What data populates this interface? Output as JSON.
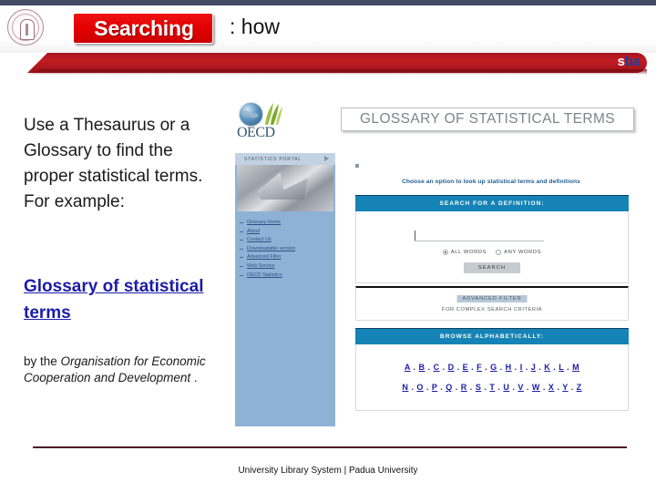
{
  "header": {
    "title_chip": "Searching",
    "title_rest": ": how",
    "brand_logo": {
      "s": "s",
      "b": "b",
      "a": "a"
    },
    "seal_name": "university-seal",
    "band_color": "#c31d22",
    "topbar_color": "#434a63"
  },
  "left_column": {
    "body_text": "Use a Thesaurus or a Glossary to find the proper statistical terms. For example:",
    "link_text": "Glossary of statistical terms",
    "link_color": "#1c1ca8",
    "credit_prefix": "by the ",
    "credit_italic": "Organisation for Economic Cooperation and Development",
    "credit_suffix": " ."
  },
  "screenshot": {
    "oecd_wordmark": "OECD",
    "page_title": "GLOSSARY OF STATISTICAL TERMS",
    "portal_bar_label": "STATISTICS PORTAL",
    "sidebar_links": [
      "Glossary Home",
      "About",
      "Contact Us",
      "Downloadable version",
      "Advanced Filter",
      "Web Service",
      "OECD Statistics"
    ],
    "choose_line": "Choose an option to look up statistical terms and definitions",
    "search_panel": {
      "heading": "SEARCH FOR A DEFINITION:",
      "input_value": "",
      "input_placeholder": "",
      "radio_all": "ALL WORDS",
      "radio_any": "ANY WORDS",
      "radio_selected": "ALL WORDS",
      "button_label": "SEARCH"
    },
    "filter_panel": {
      "button_label": "ADVANCED FILTER",
      "subtitle": "FOR COMPLEX SEARCH CRITERIA"
    },
    "browse_panel": {
      "heading": "BROWSE ALPHABETICALLY:",
      "row1": [
        "A",
        "B",
        "C",
        "D",
        "E",
        "F",
        "G",
        "H",
        "I",
        "J",
        "K",
        "L",
        "M"
      ],
      "row2": [
        "N",
        "O",
        "P",
        "Q",
        "R",
        "S",
        "T",
        "U",
        "V",
        "W",
        "X",
        "Y",
        "Z"
      ]
    },
    "colors": {
      "panel_blue": "#1583b5",
      "sidebar_blue": "#8eb2d6",
      "link_blue": "#2f4f86"
    }
  },
  "footer": {
    "text": "University Library System | Padua University",
    "rule_color": "#4c1426"
  }
}
